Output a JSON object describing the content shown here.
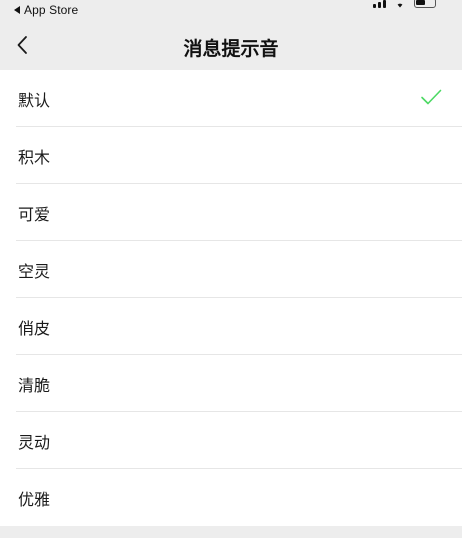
{
  "status_bar": {
    "back_app_label": "App Store",
    "icons": [
      "signal-icon",
      "wifi-icon",
      "battery-icon"
    ]
  },
  "nav": {
    "title": "消息提示音",
    "back_icon": "chevron-left-icon"
  },
  "sounds": [
    {
      "label": "默认",
      "selected": true
    },
    {
      "label": "积木",
      "selected": false
    },
    {
      "label": "可爱",
      "selected": false
    },
    {
      "label": "空灵",
      "selected": false
    },
    {
      "label": "俏皮",
      "selected": false
    },
    {
      "label": "清脆",
      "selected": false
    },
    {
      "label": "灵动",
      "selected": false
    },
    {
      "label": "优雅",
      "selected": false
    }
  ],
  "colors": {
    "background": "#ededed",
    "list_background": "#ffffff",
    "check": "#4cd964",
    "text": "#1a1a1a"
  }
}
